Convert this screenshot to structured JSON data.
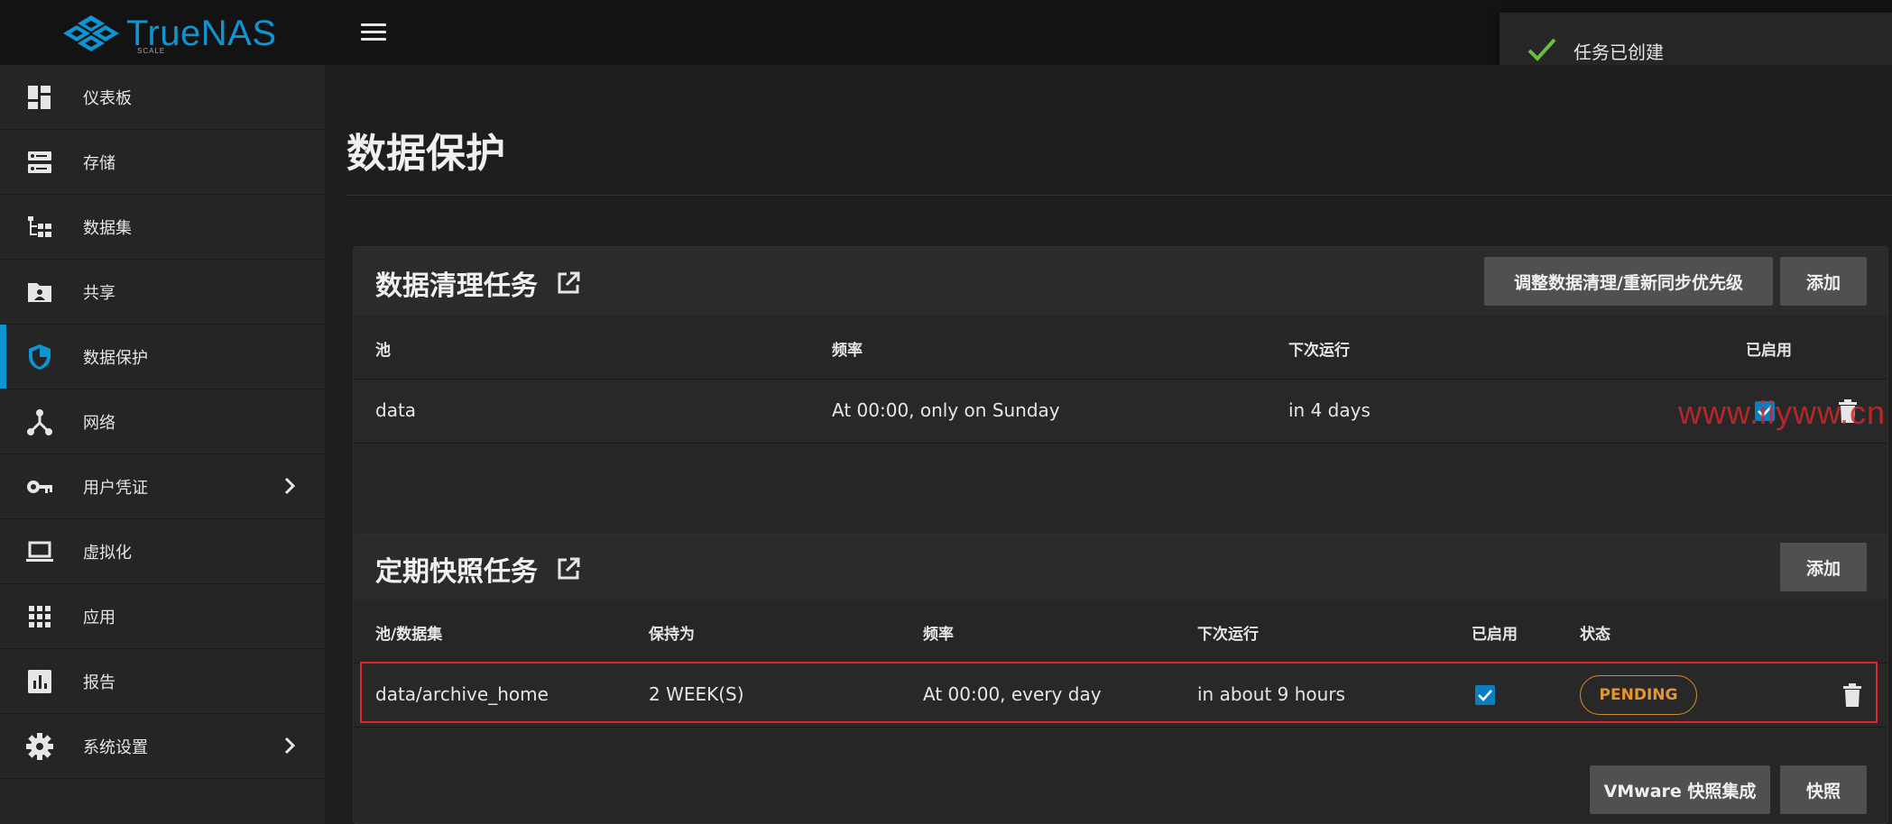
{
  "app": {
    "logo_text": "TrueNAS",
    "logo_sub": "SCALE"
  },
  "toast": {
    "text": "任务已创建"
  },
  "sidebar": {
    "items": [
      {
        "label": "仪表板",
        "icon": "dashboard-icon"
      },
      {
        "label": "存储",
        "icon": "storage-icon"
      },
      {
        "label": "数据集",
        "icon": "datasets-icon"
      },
      {
        "label": "共享",
        "icon": "shares-icon"
      },
      {
        "label": "数据保护",
        "icon": "shield-icon",
        "active": true
      },
      {
        "label": "网络",
        "icon": "network-icon"
      },
      {
        "label": "用户凭证",
        "icon": "key-icon",
        "expandable": true
      },
      {
        "label": "虚拟化",
        "icon": "laptop-icon"
      },
      {
        "label": "应用",
        "icon": "apps-grid-icon"
      },
      {
        "label": "报告",
        "icon": "reports-icon"
      },
      {
        "label": "系统设置",
        "icon": "gear-icon",
        "expandable": true
      }
    ]
  },
  "page": {
    "title": "数据保护"
  },
  "scrub": {
    "title": "数据清理任务",
    "priority_button": "调整数据清理/重新同步优先级",
    "add_button": "添加",
    "columns": [
      "池",
      "频率",
      "下次运行",
      "已启用"
    ],
    "rows": [
      {
        "pool": "data",
        "frequency": "At 00:00, only on Sunday",
        "next_run": "in 4 days",
        "enabled": true
      }
    ]
  },
  "snapshot": {
    "title": "定期快照任务",
    "add_button": "添加",
    "columns": [
      "池/数据集",
      "保持为",
      "频率",
      "下次运行",
      "已启用",
      "状态"
    ],
    "rows": [
      {
        "dataset": "data/archive_home",
        "keep_for": "2 WEEK(S)",
        "frequency": "At 00:00, every day",
        "next_run": "in about 9 hours",
        "enabled": true,
        "status": "PENDING"
      }
    ],
    "vmware_button": "VMware 快照集成",
    "snapshots_button": "快照"
  },
  "watermark": {
    "text": "www.iiyww.cn"
  },
  "colors": {
    "accent": "#0d95d3",
    "pending": "#e8952e",
    "highlight": "#e0232c",
    "success": "#6bbf3e"
  }
}
